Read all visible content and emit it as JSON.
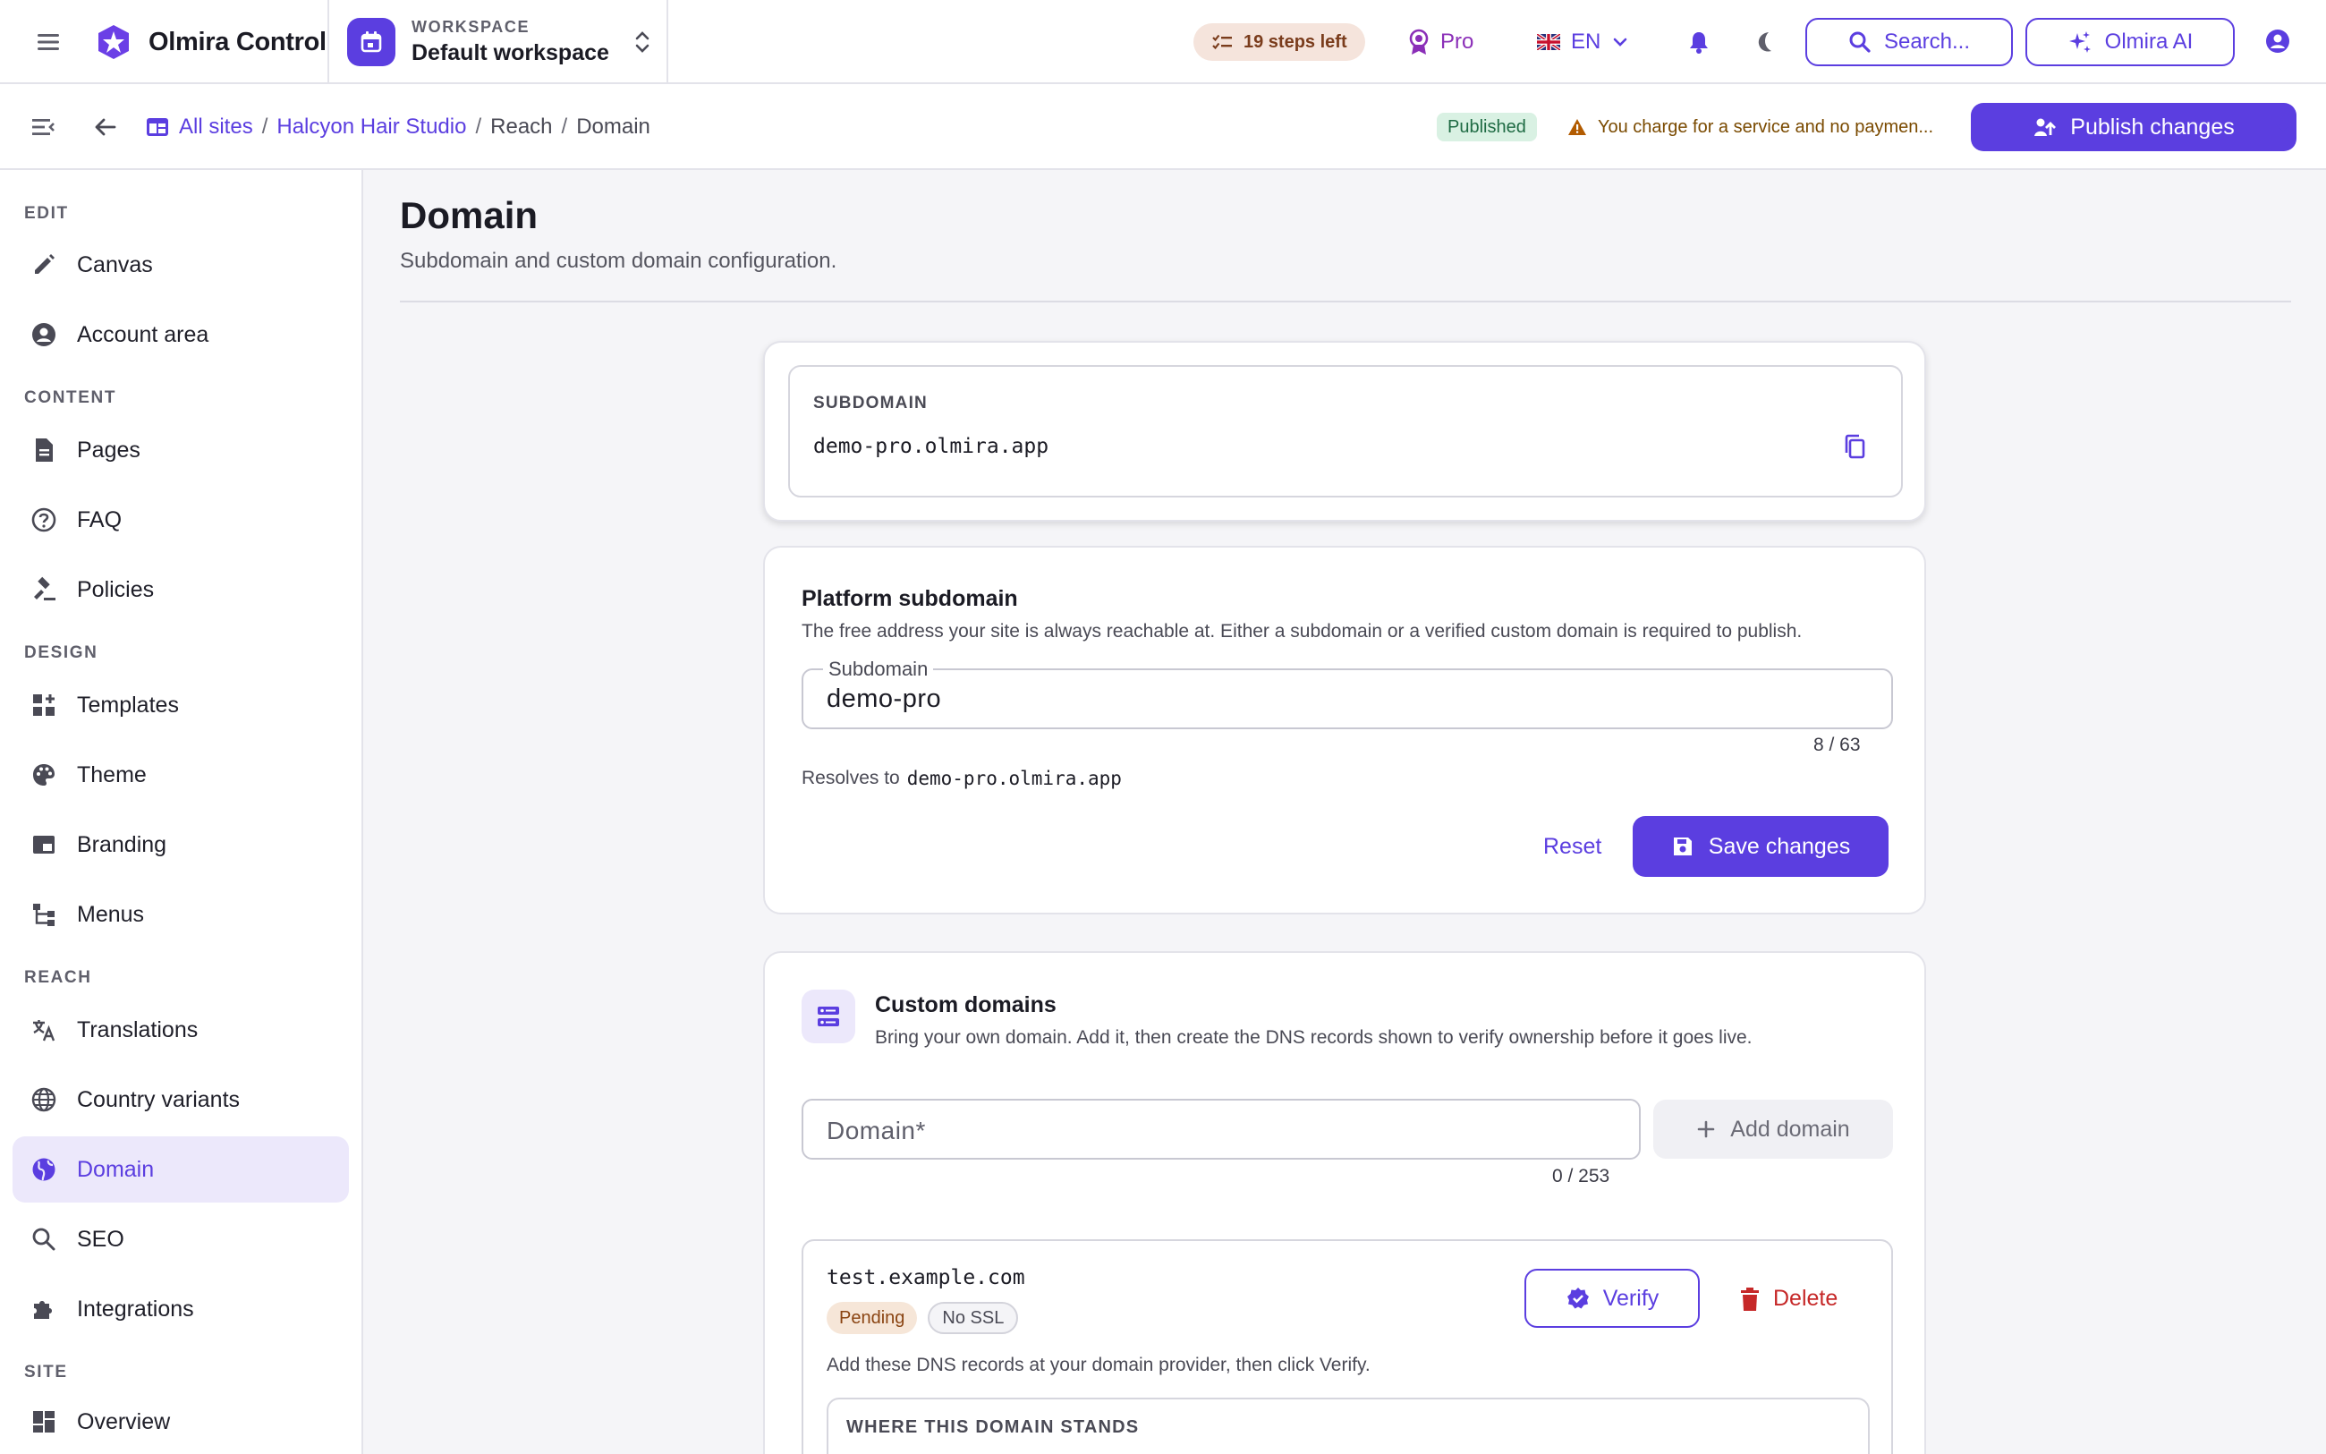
{
  "topbar": {
    "app_name": "Olmira Control",
    "workspace_label": "WORKSPACE",
    "workspace_name": "Default workspace",
    "steps_left": "19 steps left",
    "plan": "Pro",
    "language": "EN",
    "search_label": "Search...",
    "ai_label": "Olmira AI"
  },
  "subbar": {
    "breadcrumb": [
      "All sites",
      "Halcyon Hair Studio",
      "Reach",
      "Domain"
    ],
    "status": "Published",
    "warning": "You charge for a service and no paymen...",
    "publish_label": "Publish changes"
  },
  "sidebar": {
    "sections": {
      "edit": "EDIT",
      "content": "CONTENT",
      "design": "DESIGN",
      "reach": "REACH",
      "site": "SITE"
    },
    "items": {
      "canvas": "Canvas",
      "account_area": "Account area",
      "pages": "Pages",
      "faq": "FAQ",
      "policies": "Policies",
      "templates": "Templates",
      "theme": "Theme",
      "branding": "Branding",
      "menus": "Menus",
      "translations": "Translations",
      "country_variants": "Country variants",
      "domain": "Domain",
      "seo": "SEO",
      "integrations": "Integrations",
      "overview": "Overview"
    },
    "active": "domain"
  },
  "main": {
    "title": "Domain",
    "subtitle": "Subdomain and custom domain configuration.",
    "subdomain_card": {
      "label": "SUBDOMAIN",
      "value": "demo-pro.olmira.app"
    },
    "platform": {
      "title": "Platform subdomain",
      "description": "The free address your site is always reachable at. Either a subdomain or a verified custom domain is required to publish.",
      "field_label": "Subdomain",
      "field_value": "demo-pro",
      "counter": "8 / 63",
      "resolves_prefix": "Resolves to",
      "resolves_value": "demo-pro.olmira.app",
      "reset_label": "Reset",
      "save_label": "Save changes"
    },
    "custom": {
      "title": "Custom domains",
      "description": "Bring your own domain. Add it, then create the DNS records shown to verify ownership before it goes live.",
      "input_placeholder": "Domain*",
      "counter": "0 / 253",
      "add_label": "Add domain",
      "domain": {
        "name": "test.example.com",
        "badge_pending": "Pending",
        "badge_ssl": "No SSL",
        "verify_label": "Verify",
        "delete_label": "Delete",
        "instructions": "Add these DNS records at your domain provider, then click Verify.",
        "status_heading": "WHERE THIS DOMAIN STANDS"
      }
    }
  },
  "colors": {
    "accent": "#5b3ee0",
    "danger": "#c62828",
    "warning": "#b25b00",
    "success_bg": "#d9f1e3"
  }
}
